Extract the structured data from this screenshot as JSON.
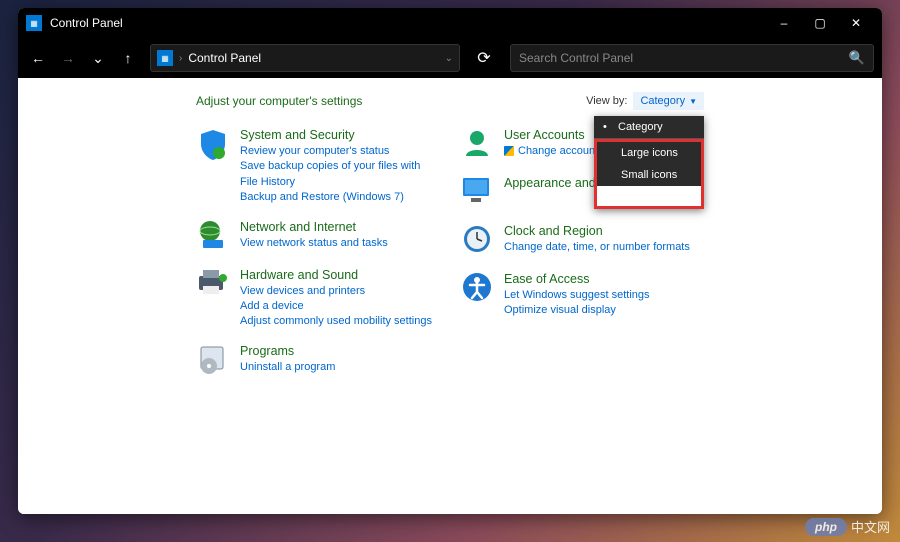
{
  "window": {
    "title": "Control Panel",
    "min_label": "–",
    "max_label": "▢",
    "close_label": "✕"
  },
  "nav": {
    "back": "←",
    "fwd": "→",
    "dropdown": "⌄",
    "up": "↑",
    "refresh": "⟳"
  },
  "address": {
    "root": "Control Panel",
    "chevron": "›"
  },
  "search": {
    "placeholder": "Search Control Panel",
    "icon": "🔍"
  },
  "content": {
    "heading": "Adjust your computer's settings",
    "viewby_label": "View by:",
    "viewby_value": "Category"
  },
  "dropdown": {
    "items": [
      {
        "label": "Category",
        "selected": true
      },
      {
        "label": "Large icons",
        "selected": false
      },
      {
        "label": "Small icons",
        "selected": false
      }
    ]
  },
  "left_categories": [
    {
      "title": "System and Security",
      "links": [
        "Review your computer's status",
        "Save backup copies of your files with File History",
        "Backup and Restore (Windows 7)"
      ]
    },
    {
      "title": "Network and Internet",
      "links": [
        "View network status and tasks"
      ]
    },
    {
      "title": "Hardware and Sound",
      "links": [
        "View devices and printers",
        "Add a device",
        "Adjust commonly used mobility settings"
      ]
    },
    {
      "title": "Programs",
      "links": [
        "Uninstall a program"
      ]
    }
  ],
  "right_categories": [
    {
      "title": "User Accounts",
      "links": [
        "Change account type"
      ],
      "shield": [
        true
      ]
    },
    {
      "title": "Appearance and Personalization",
      "links": []
    },
    {
      "title": "Clock and Region",
      "links": [
        "Change date, time, or number formats"
      ]
    },
    {
      "title": "Ease of Access",
      "links": [
        "Let Windows suggest settings",
        "Optimize visual display"
      ]
    }
  ],
  "watermark": {
    "badge": "php",
    "text": "中文网"
  }
}
